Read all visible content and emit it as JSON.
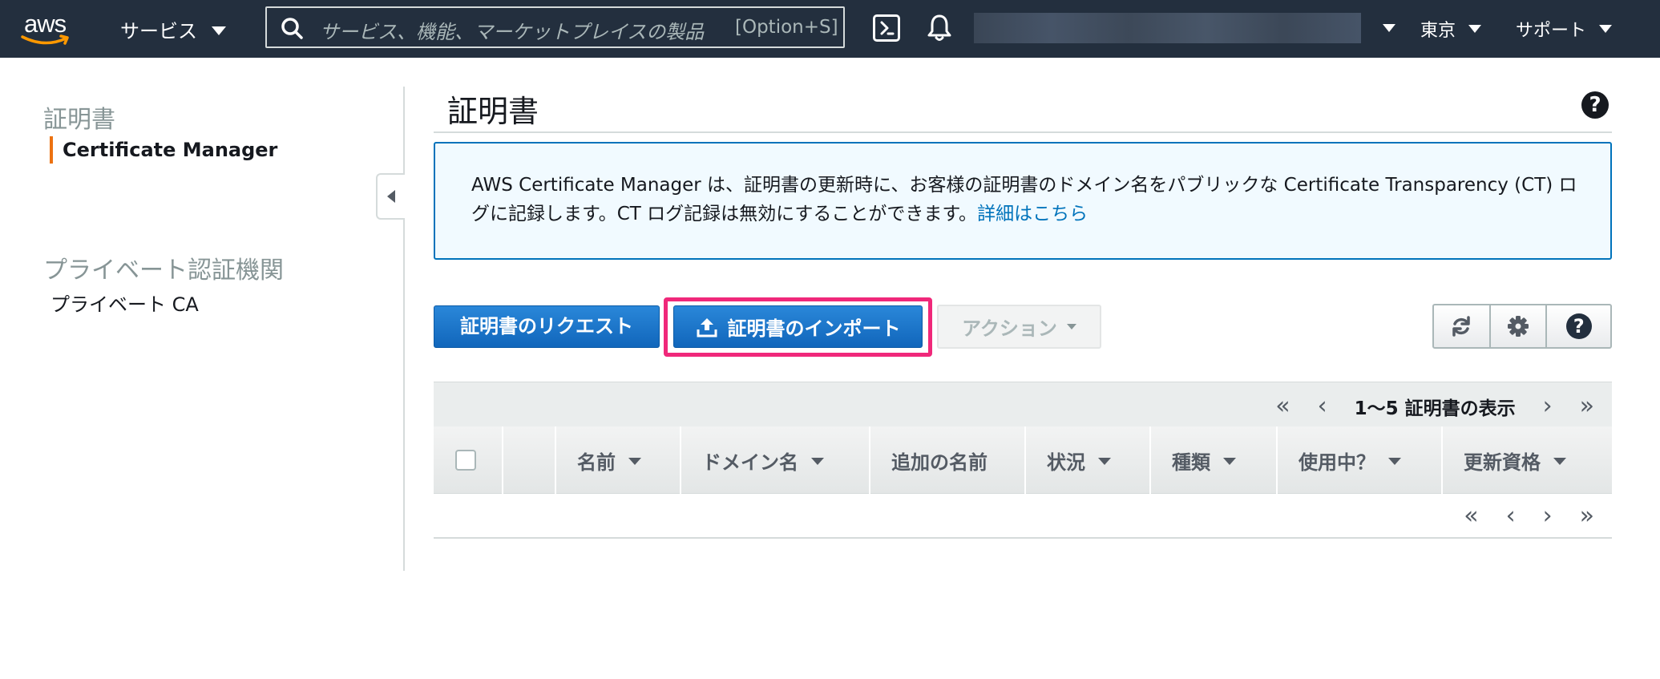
{
  "topnav": {
    "logo_text": "aws",
    "services_label": "サービス",
    "search_placeholder": "サービス、機能、マーケットプレイスの製品",
    "search_shortcut": "[Option+S]",
    "region_label": "東京",
    "support_label": "サポート"
  },
  "sidebar": {
    "section1_title": "証明書",
    "section1_item": "Certificate Manager",
    "section2_title": "プライベート認証機関",
    "section2_item": "プライベート CA"
  },
  "main": {
    "title": "証明書",
    "info_text": "AWS Certificate Manager は、証明書の更新時に、お客様の証明書のドメイン名をパブリックな Certificate Transparency (CT) ログに記録します。CT ログ記録は無効にすることができます。",
    "info_link": "詳細はこちら",
    "request_button": "証明書のリクエスト",
    "import_button": "証明書のインポート",
    "actions_button": "アクション",
    "pager_label": "1〜5 証明書の表示",
    "columns": [
      "名前",
      "ドメイン名",
      "追加の名前",
      "状況",
      "種類",
      "使用中？",
      "更新資格"
    ]
  },
  "colors": {
    "nav_bg": "#232f3e",
    "primary": "#1166bb",
    "accent": "#ec7211",
    "highlight": "#f0287a",
    "link": "#0073bb"
  },
  "icons": [
    "search-icon",
    "cloudshell-icon",
    "bell-icon",
    "upload-icon",
    "refresh-icon",
    "gear-icon",
    "help-icon"
  ]
}
